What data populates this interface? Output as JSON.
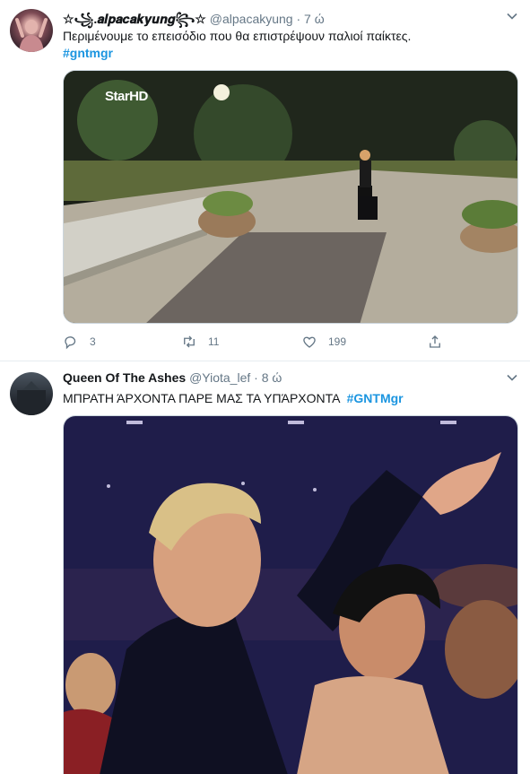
{
  "tweets": [
    {
      "display_name": "☆꧁.𝒂𝒍𝒑𝒂𝒄𝒂𝒌𝒚𝒖𝒏𝒈꧂☆",
      "handle": "@alpacakyung",
      "separator": "·",
      "time": "7 ώ",
      "text": "Περιμένουμε το επεισόδιο που θα επιστρέψουν παλιοί παίκτες.",
      "hashtag": "#gntmgr",
      "media_overlay": "StarHD",
      "replies": "3",
      "retweets": "11",
      "likes": "199"
    },
    {
      "display_name": "Queen Of The Ashes",
      "handle": "@Yiota_lef",
      "separator": "·",
      "time": "8 ώ",
      "text": "ΜΠΡΑΤΗ ΆΡΧΟΝΤΑ ΠΑΡΕ ΜΑΣ ΤΑ ΥΠΆΡΧΟΝΤΑ",
      "hashtag": "#GNTMgr"
    }
  ],
  "icons": [
    "reply-icon",
    "retweet-icon",
    "like-icon",
    "share-icon",
    "chevron-down-icon"
  ],
  "colors": {
    "link": "#1b95e0",
    "secondary": "#657786",
    "border": "#e6ecf0"
  }
}
